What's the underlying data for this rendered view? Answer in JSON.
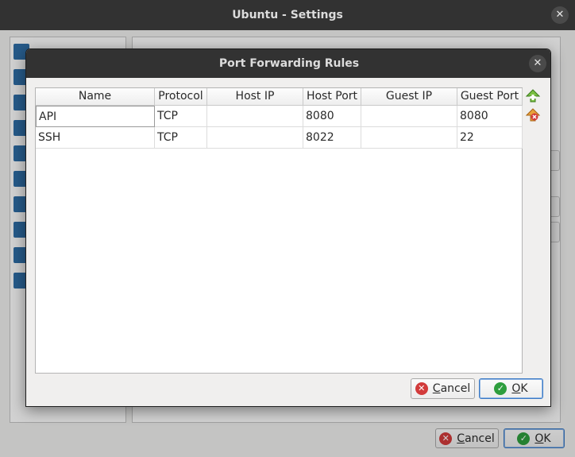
{
  "settings": {
    "title": "Ubuntu - Settings",
    "close_glyph": "✕",
    "cancel_label": "Cancel",
    "ok_label": "OK"
  },
  "dialog": {
    "title": "Port Forwarding Rules",
    "close_glyph": "✕",
    "cancel_label": "Cancel",
    "ok_label": "OK"
  },
  "table": {
    "columns": [
      "Name",
      "Protocol",
      "Host IP",
      "Host Port",
      "Guest IP",
      "Guest Port"
    ],
    "rows": [
      {
        "name": "API",
        "protocol": "TCP",
        "host_ip": "",
        "host_port": "8080",
        "guest_ip": "",
        "guest_port": "8080"
      },
      {
        "name": "SSH",
        "protocol": "TCP",
        "host_ip": "",
        "host_port": "8022",
        "guest_ip": "",
        "guest_port": "22"
      }
    ]
  },
  "icons": {
    "add_rule": "add-rule-icon",
    "remove_rule": "remove-rule-icon",
    "cancel": "cancel-icon",
    "ok": "ok-icon"
  },
  "colors": {
    "titlebar": "#323232",
    "ok_border": "#3b79c4",
    "cancel_icon": "#d23b3b",
    "ok_icon": "#2e9e3e"
  }
}
